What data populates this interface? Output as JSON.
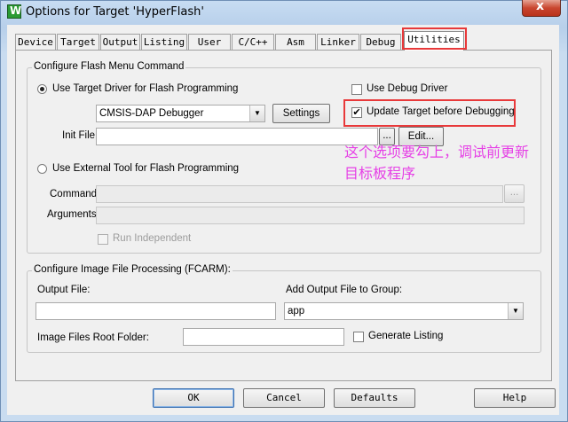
{
  "window": {
    "title": "Options for Target 'HyperFlash'",
    "close_glyph": "x",
    "icon_glyph": "W"
  },
  "tabs": [
    {
      "label": "Device"
    },
    {
      "label": "Target"
    },
    {
      "label": "Output"
    },
    {
      "label": "Listing"
    },
    {
      "label": "User"
    },
    {
      "label": "C/C++"
    },
    {
      "label": "Asm"
    },
    {
      "label": "Linker"
    },
    {
      "label": "Debug"
    },
    {
      "label": "Utilities",
      "selected": true
    }
  ],
  "flash": {
    "group_label": "Configure Flash Menu Command",
    "use_target_driver_label": "Use Target Driver for Flash Programming",
    "use_debug_driver_label": "Use Debug Driver",
    "driver_value": "CMSIS-DAP Debugger",
    "settings_label": "Settings",
    "update_target_label": "Update Target before Debugging",
    "update_target_checked": true,
    "init_file_label": "Init File:",
    "init_file_value": "",
    "browse_label": "...",
    "edit_label": "Edit...",
    "use_external_tool_label": "Use External Tool for Flash Programming",
    "command_label": "Command:",
    "arguments_label": "Arguments:",
    "run_independent_label": "Run Independent"
  },
  "annotation": {
    "line1": "这个选项要勾上，调试前更新",
    "line2": "目标板程序"
  },
  "image": {
    "group_label": "Configure Image File Processing (FCARM):",
    "output_file_label": "Output File:",
    "add_output_label": "Add Output File  to Group:",
    "group_value": "app",
    "root_folder_label": "Image Files Root Folder:",
    "generate_listing_label": "Generate Listing"
  },
  "buttons": {
    "ok": "OK",
    "cancel": "Cancel",
    "defaults": "Defaults",
    "help": "Help"
  },
  "colors": {
    "highlight": "#e8393a",
    "annotation": "#e640e6"
  }
}
